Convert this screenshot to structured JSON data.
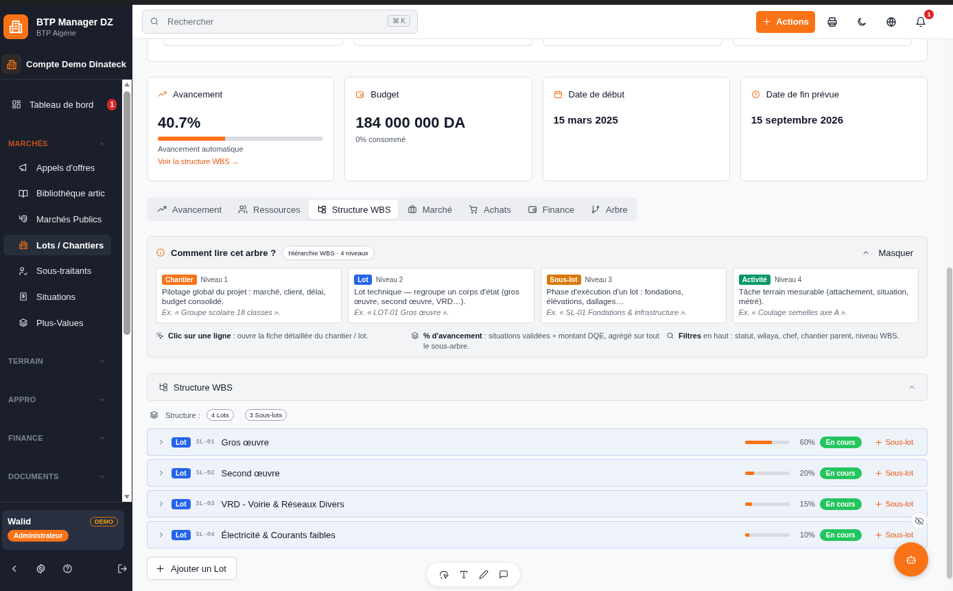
{
  "sidebar": {
    "brand": {
      "title": "BTP Manager DZ",
      "subtitle": "BTP Algérie"
    },
    "account": "Compte Demo Dinateck",
    "items": [
      {
        "label": "Tableau de bord",
        "badge": "1",
        "selected": false
      }
    ],
    "sections": [
      {
        "title": "MARCHÉS",
        "expanded": true,
        "items": [
          {
            "label": "Appels d'offres",
            "selected": false
          },
          {
            "label": "Bibliothèque artic",
            "selected": false
          },
          {
            "label": "Marchés Publics",
            "selected": false
          },
          {
            "label": "Lots / Chantiers",
            "selected": true
          },
          {
            "label": "Sous-traitants",
            "selected": false
          },
          {
            "label": "Situations",
            "selected": false
          },
          {
            "label": "Plus-Values",
            "selected": false
          }
        ]
      },
      {
        "title": "TERRAIN",
        "expanded": false
      },
      {
        "title": "APPRO",
        "expanded": false
      },
      {
        "title": "FINANCE",
        "expanded": false
      },
      {
        "title": "DOCUMENTS",
        "expanded": false
      }
    ],
    "user": {
      "name": "Walid",
      "tag": "DEMO",
      "role": "Administrateur"
    }
  },
  "topbar": {
    "search": {
      "placeholder": "Rechercher",
      "shortcut": "⌘ K"
    },
    "action": "Actions",
    "notification_count": "1"
  },
  "stats": [
    {
      "kind": "progress",
      "title": "Avancement",
      "value": "40.7%",
      "level": 0.407,
      "note": "Avancement automatique",
      "link": "Voir la structure WBS →"
    },
    {
      "kind": "amount",
      "title": "Budget",
      "value": "184 000 000 DA",
      "note": "0% consommé"
    },
    {
      "kind": "date",
      "title": "Date de début",
      "value": "15 mars 2025"
    },
    {
      "kind": "date",
      "title": "Date de fin prévue",
      "value": "15 septembre 2026"
    }
  ],
  "tabs": [
    {
      "label": "Avancement",
      "selected": false
    },
    {
      "label": "Ressources",
      "selected": false
    },
    {
      "label": "Structure WBS",
      "selected": true
    },
    {
      "label": "Marché",
      "selected": false
    },
    {
      "label": "Achats",
      "selected": false
    },
    {
      "label": "Finance",
      "selected": false
    },
    {
      "label": "Arbre",
      "selected": false
    }
  ],
  "guide": {
    "title": "Comment lire cet arbre ?",
    "pill": "Hiérarchie WBS · 4 niveaux",
    "toggle": "Masquer",
    "expanded": true,
    "levels": [
      {
        "tag": "Chantier",
        "color": "#f97316",
        "level_label": "Niveau 1",
        "description": "Pilotage global du projet : marché, client, délai, budget consolidé.",
        "example": "Ex. « Groupe scolaire 18 classes »."
      },
      {
        "tag": "Lot",
        "color": "#2563eb",
        "level_label": "Niveau 2",
        "description": "Lot technique — regroupe un corps d'état (gros œuvre, second œuvre, VRD…).",
        "example": "Ex. « LOT-01 Gros œuvre »."
      },
      {
        "tag": "Sous-lot",
        "color": "#d97706",
        "level_label": "Niveau 3",
        "description": "Phase d'exécution d'un lot : fondations, élévations, dallages…",
        "example": "Ex. « SL-01 Fondations & infrastructure »."
      },
      {
        "tag": "Activité",
        "color": "#059669",
        "level_label": "Niveau 4",
        "description": "Tâche terrain mesurable (attachement, situation, métré).",
        "example": "Ex. « Coulage semelles axe A »."
      }
    ],
    "notes": [
      "**Clic sur une ligne** : ouvre la fiche détaillée du chantier / lot.",
      "**% d'avancement** : situations validées ÷ montant DQE, agrégé sur tout le sous-arbre.",
      "**Filtres** en haut : statut, wilaya, chef, chantier parent, niveau WBS."
    ]
  },
  "wbs": {
    "title": "Structure WBS",
    "expanded": true,
    "summary_label": "Structure :",
    "counts": [
      "4 Lots",
      "3 Sous-lots"
    ],
    "rows": [
      {
        "tag": "Lot",
        "code": "SL-01",
        "name": "Gros œuvre",
        "level": 0.6,
        "percent": "60%",
        "status": "En cours",
        "action": "Sous-lot",
        "expanded": false
      },
      {
        "tag": "Lot",
        "code": "SL-02",
        "name": "Second œuvre",
        "level": 0.2,
        "percent": "20%",
        "status": "En cours",
        "action": "Sous-lot",
        "expanded": false
      },
      {
        "tag": "Lot",
        "code": "SL-03",
        "name": "VRD - Voirie & Réseaux Divers",
        "level": 0.15,
        "percent": "15%",
        "status": "En cours",
        "action": "Sous-lot",
        "expanded": false
      },
      {
        "tag": "Lot",
        "code": "SL-04",
        "name": "Électricité & Courants faibles",
        "level": 0.1,
        "percent": "10%",
        "status": "En cours",
        "action": "Sous-lot",
        "expanded": false
      }
    ],
    "add_button": "Ajouter un Lot"
  }
}
